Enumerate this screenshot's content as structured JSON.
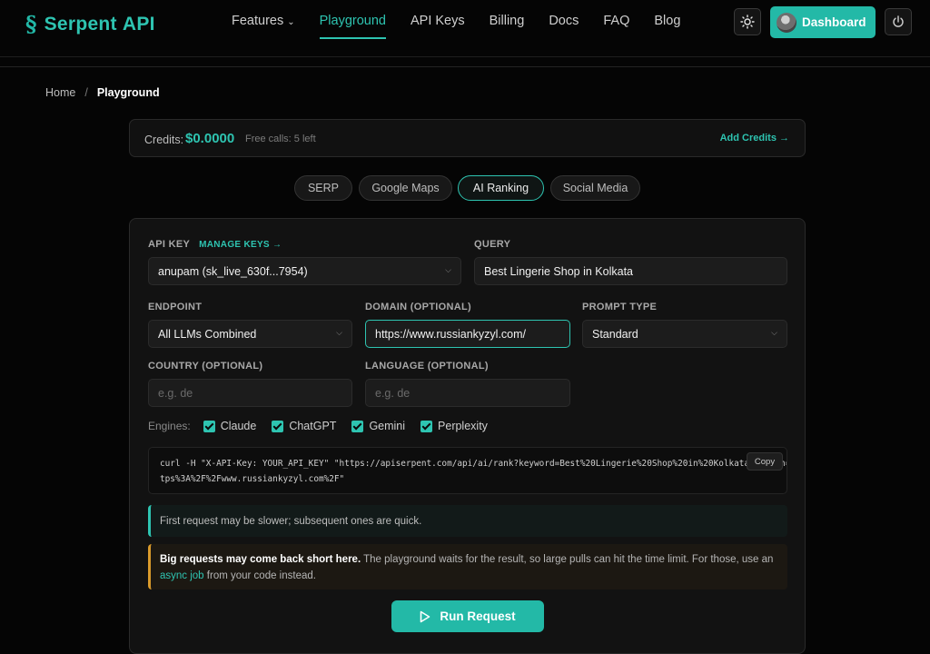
{
  "brand": {
    "name": "Serpent",
    "suffix": "API",
    "color": "#2ec4b1"
  },
  "nav": {
    "links": [
      {
        "label": "Features",
        "has_dropdown": true
      },
      {
        "label": "Playground",
        "active": true
      },
      {
        "label": "API Keys"
      },
      {
        "label": "Billing"
      },
      {
        "label": "Docs"
      },
      {
        "label": "FAQ"
      },
      {
        "label": "Blog"
      }
    ],
    "theme_icon": "sun-icon",
    "dashboard_label": "Dashboard",
    "power_icon": "power-icon"
  },
  "breadcrumb": {
    "home": "Home",
    "separator": "/",
    "current": "Playground"
  },
  "credits": {
    "label": "Credits:",
    "amount": "$0.0000",
    "free_calls": "Free calls: 5 left",
    "add_label": "Add Credits →"
  },
  "tabs": [
    {
      "label": "SERP"
    },
    {
      "label": "Google Maps"
    },
    {
      "label": "AI Ranking",
      "active": true
    },
    {
      "label": "Social Media"
    }
  ],
  "form": {
    "api_key": {
      "label": "API KEY",
      "manage_label": "MANAGE KEYS →",
      "value": "anupam (sk_live_630f...7954)"
    },
    "query": {
      "label": "QUERY",
      "value": "Best Lingerie Shop in Kolkata"
    },
    "endpoint": {
      "label": "ENDPOINT",
      "value": "All LLMs Combined"
    },
    "domain": {
      "label": "DOMAIN (OPTIONAL)",
      "value": "https://www.russiankyzyl.com/"
    },
    "prompt_type": {
      "label": "PROMPT TYPE",
      "value": "Standard"
    },
    "country": {
      "label": "COUNTRY (OPTIONAL)",
      "placeholder": "e.g. de"
    },
    "language": {
      "label": "LANGUAGE (OPTIONAL)",
      "placeholder": "e.g. de"
    }
  },
  "engines": {
    "label": "Engines:",
    "items": [
      {
        "label": "Claude",
        "checked": true
      },
      {
        "label": "ChatGPT",
        "checked": true
      },
      {
        "label": "Gemini",
        "checked": true
      },
      {
        "label": "Perplexity",
        "checked": true
      }
    ]
  },
  "code": {
    "line1": "curl -H \"X-API-Key: YOUR_API_KEY\" \"https://apiserpent.com/api/ai/rank?keyword=Best%20Lingerie%20Shop%20in%20Kolkata&domain=ht",
    "line2": "tps%3A%2F%2Fwww.russiankyzyl.com%2F\"",
    "copy_label": "Copy"
  },
  "info_note": "First request may be slower; subsequent ones are quick.",
  "warning": {
    "bold": "Big requests may come back short here.",
    "text": " The playground waits for the result, so large pulls can hit the time limit. For those, use an",
    "link": "async job",
    "tail": " from your code instead."
  },
  "run_label": "Run Request"
}
